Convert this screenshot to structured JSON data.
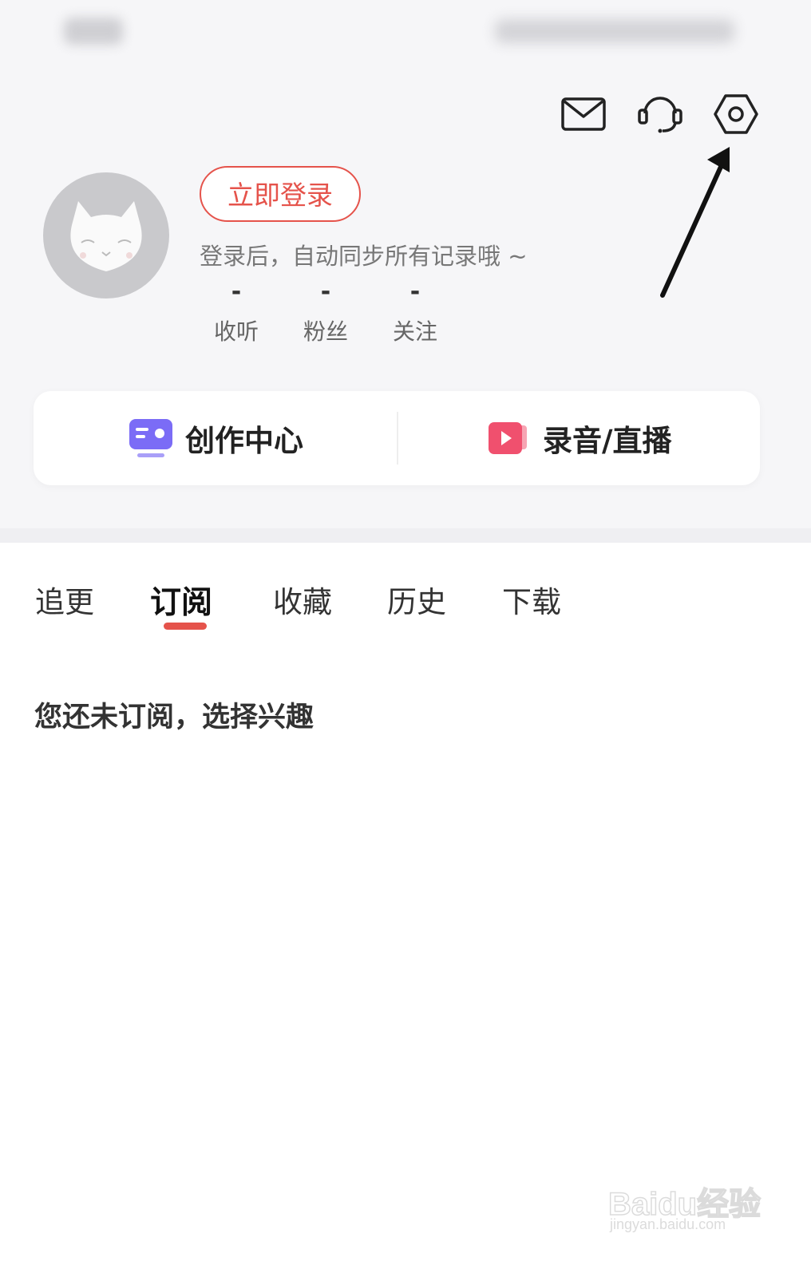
{
  "topbar": {
    "icons": [
      "mail-icon",
      "customer-service-headset-icon",
      "settings-gear-icon"
    ]
  },
  "profile": {
    "login_button": "立即登录",
    "login_hint": "登录后，自动同步所有记录哦 ~",
    "stats": [
      {
        "value": "-",
        "label": "收听"
      },
      {
        "value": "-",
        "label": "粉丝"
      },
      {
        "value": "-",
        "label": "关注"
      }
    ]
  },
  "actions": {
    "create_center": {
      "label": "创作中心",
      "icon": "creator-center-icon"
    },
    "record_live": {
      "label": "录音/直播",
      "icon": "record-live-icon"
    }
  },
  "tabs": {
    "items": [
      "追更",
      "订阅",
      "收藏",
      "历史",
      "下载"
    ],
    "active": "订阅"
  },
  "content": {
    "empty_message": "您还未订阅，选择兴趣"
  },
  "watermark": {
    "brand": "Baidu经验",
    "url": "jingyan.baidu.com"
  },
  "colors": {
    "accent": "#e5534b",
    "create_icon": "#7b6cf6",
    "record_icon": "#f0506e"
  }
}
